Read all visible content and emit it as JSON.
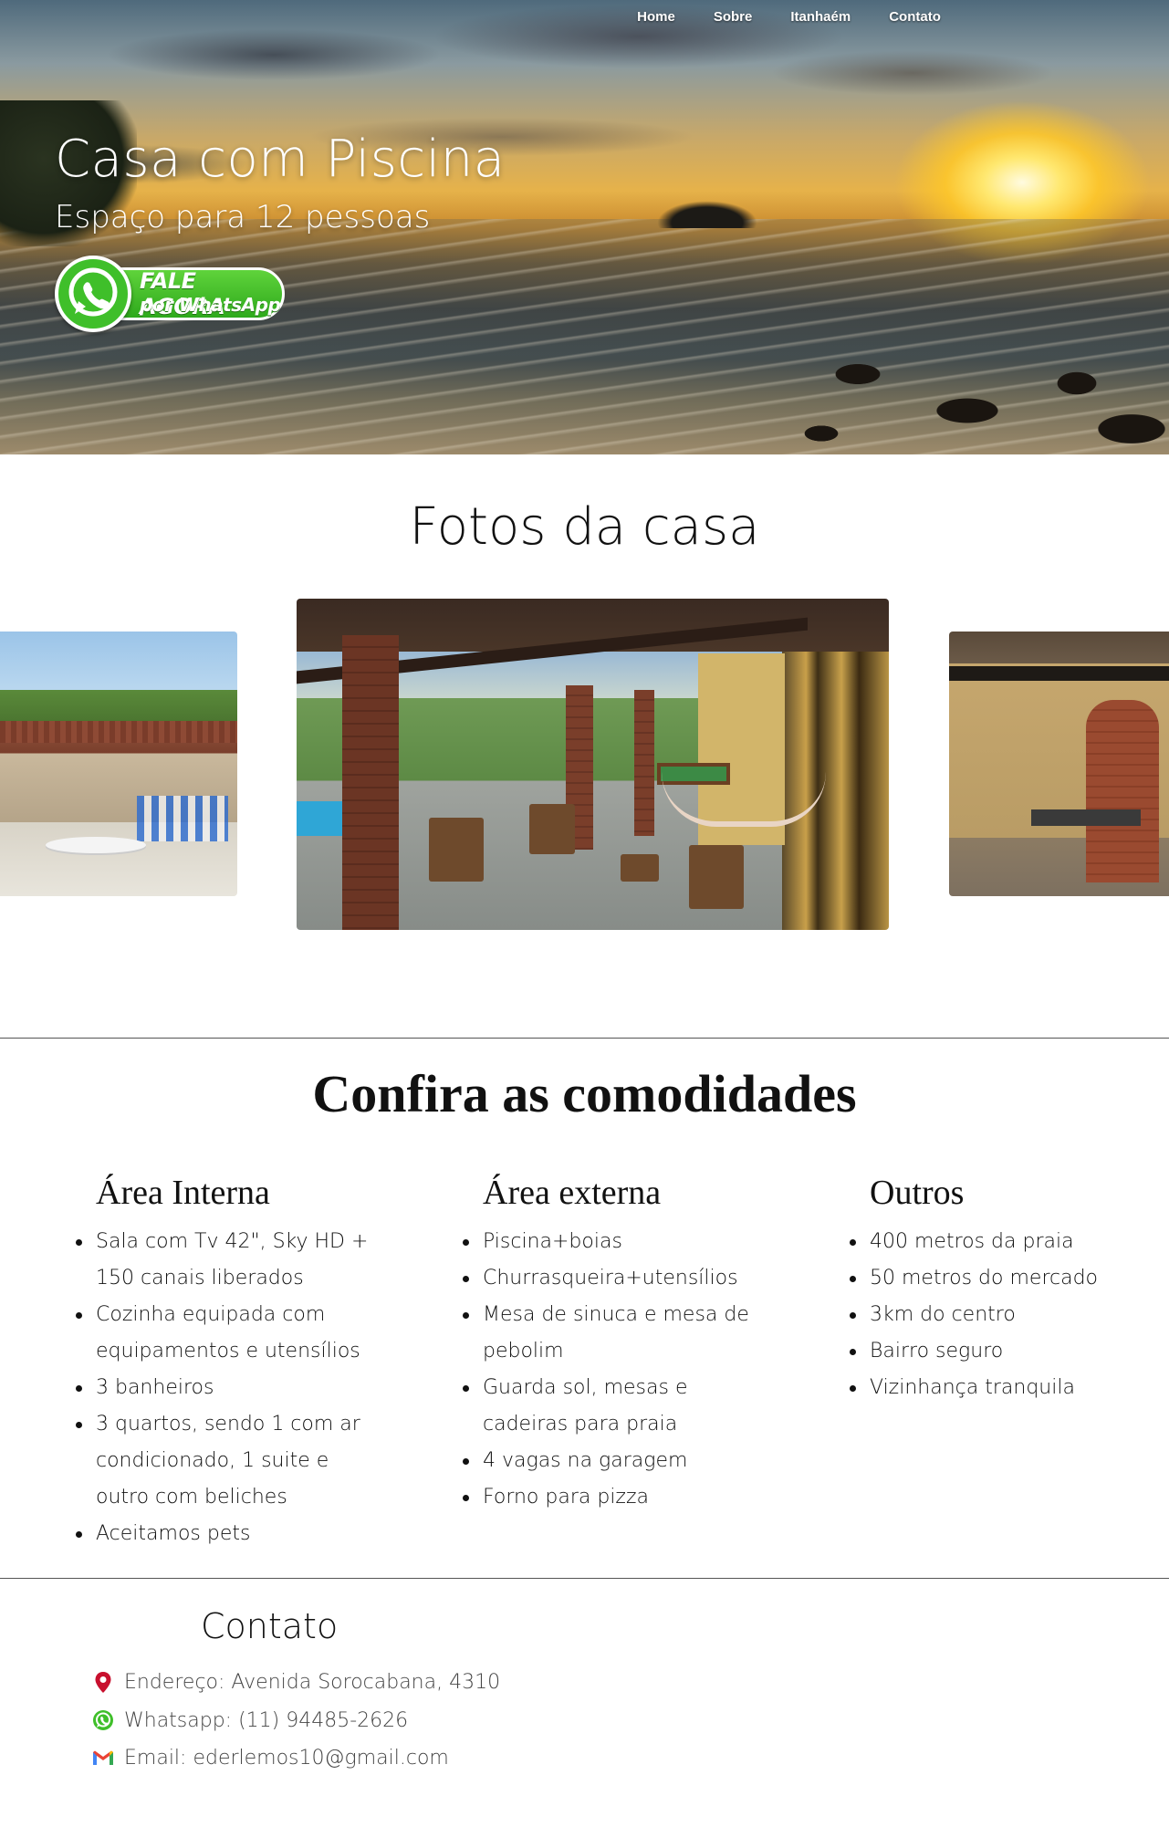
{
  "nav": {
    "items": [
      {
        "label": "Home"
      },
      {
        "label": "Sobre"
      },
      {
        "label": "Itanhaém"
      },
      {
        "label": "Contato"
      }
    ]
  },
  "hero": {
    "title": "Casa com Piscina",
    "subtitle": "Espaço para 12 pessoas",
    "whatsapp_button": {
      "line1": "FALE AGORA",
      "line2": "por WhatsApp"
    }
  },
  "photos": {
    "title": "Fotos da casa"
  },
  "amenities": {
    "title": "Confira as comodidades",
    "columns": [
      {
        "heading": "Área Interna",
        "items": [
          "Sala com Tv 42\", Sky HD + 150 canais liberados",
          "Cozinha equipada com equipamentos e utensílios",
          "3 banheiros",
          "3 quartos, sendo 1 com ar condicionado, 1 suite e outro com beliches",
          "Aceitamos pets"
        ]
      },
      {
        "heading": "Área externa",
        "items": [
          "Piscina+boias",
          "Churrasqueira+utensílios",
          "Mesa de sinuca e mesa de pebolim",
          "Guarda sol, mesas e cadeiras para praia",
          "4 vagas na garagem",
          "Forno para pizza"
        ]
      },
      {
        "heading": "Outros",
        "items": [
          "400 metros da praia",
          "50 metros do mercado",
          "3km do centro",
          "Bairro seguro",
          "Vizinhança tranquila"
        ]
      }
    ]
  },
  "contact": {
    "title": "Contato",
    "address": "Endereço: Avenida Sorocabana, 4310",
    "whatsapp": "Whatsapp: (11) 94485-2626",
    "email": "Email: ederlemos10@gmail.com"
  },
  "colors": {
    "whatsapp_green": "#3fbf2a",
    "pin_red": "#c8102e",
    "gmail_red": "#ea4335"
  }
}
